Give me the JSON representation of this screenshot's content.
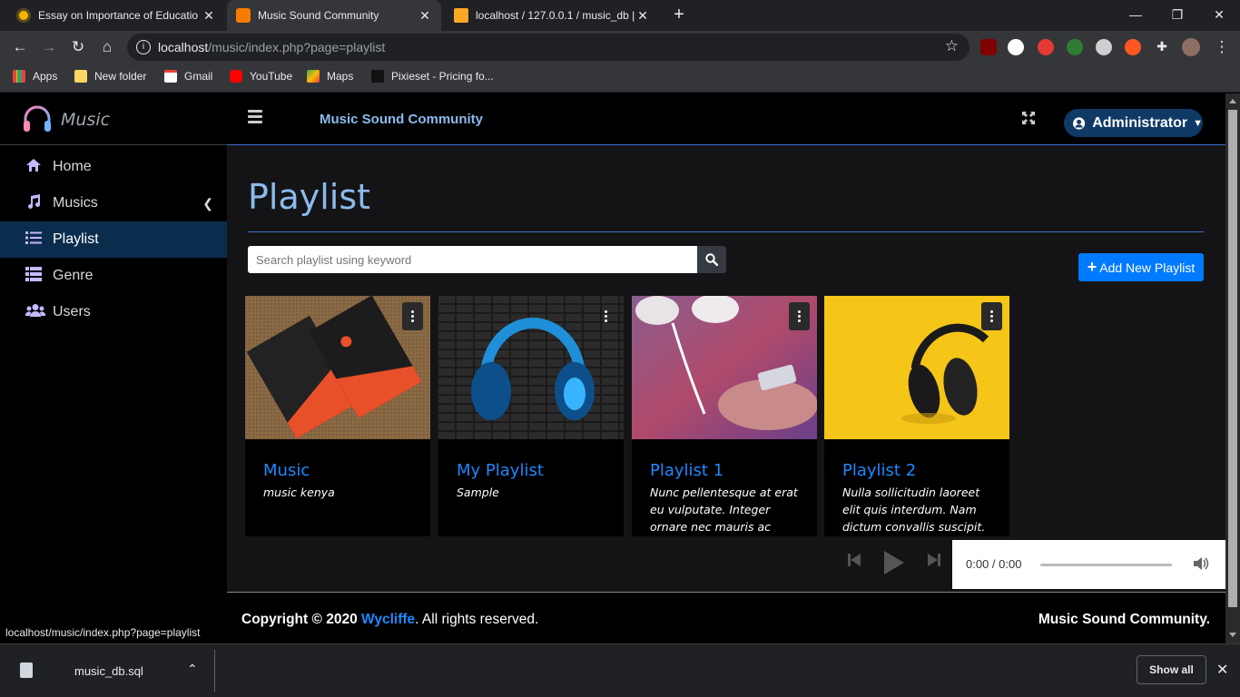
{
  "browser": {
    "tabs": [
      {
        "title": "Essay on Importance of Educatio"
      },
      {
        "title": "Music Sound Community"
      },
      {
        "title": "localhost / 127.0.0.1 / music_db |"
      }
    ],
    "new_tab_symbol": "+",
    "window_controls": {
      "minimize": "—",
      "maximize": "❐",
      "close": "✕"
    },
    "url": {
      "host": "localhost",
      "path": "/music/index.php?page=playlist"
    },
    "bookmarks": [
      {
        "label": "Apps"
      },
      {
        "label": "New folder"
      },
      {
        "label": "Gmail"
      },
      {
        "label": "YouTube"
      },
      {
        "label": "Maps"
      },
      {
        "label": "Pixieset - Pricing fo..."
      }
    ]
  },
  "app": {
    "brand": "Music",
    "site_title": "Music Sound Community",
    "user_label": "Administrator",
    "nav": [
      {
        "label": "Home",
        "icon": "home-icon"
      },
      {
        "label": "Musics",
        "icon": "music-note-icon"
      },
      {
        "label": "Playlist",
        "icon": "list-icon",
        "active": true
      },
      {
        "label": "Genre",
        "icon": "genre-icon"
      },
      {
        "label": "Users",
        "icon": "users-icon"
      }
    ]
  },
  "main": {
    "heading": "Playlist",
    "search_placeholder": "Search playlist using keyword",
    "add_button": "Add New Playlist",
    "cards": [
      {
        "title": "Music",
        "description": "music kenya"
      },
      {
        "title": "My Playlist",
        "description": "Sample"
      },
      {
        "title": "Playlist 1",
        "description": "Nunc pellentesque at erat eu vulputate. Integer ornare nec mauris ac sodales...."
      },
      {
        "title": "Playlist 2",
        "description": "Nulla sollicitudin laoreet elit quis interdum. Nam dictum convallis suscipit. Etiam in..."
      }
    ]
  },
  "player": {
    "time": "0:00 / 0:00"
  },
  "footer": {
    "copyright_prefix": "Copyright © 2020 ",
    "author": "Wycliffe",
    "copyright_suffix": ". All rights reserved.",
    "right_text": "Music Sound Community."
  },
  "status_url": "localhost/music/index.php?page=playlist",
  "downloads": {
    "file": "music_db.sql",
    "show_all": "Show all"
  },
  "colors": {
    "accent": "#007bff",
    "heading": "#8bbbec",
    "link": "#1e88ff",
    "active_nav": "#0b2d4d"
  }
}
